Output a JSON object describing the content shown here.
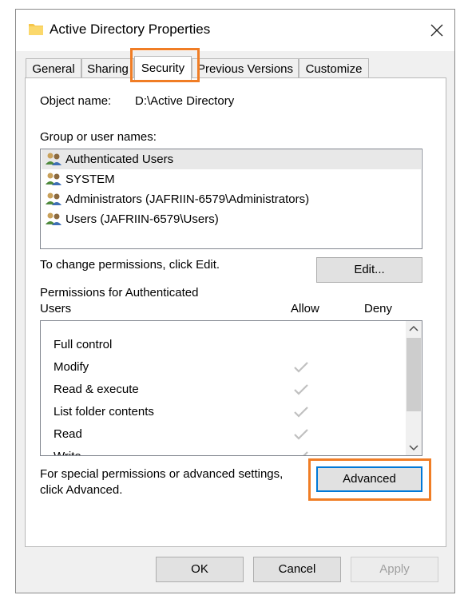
{
  "window": {
    "title": "Active Directory Properties"
  },
  "tabs": [
    {
      "label": "General"
    },
    {
      "label": "Sharing"
    },
    {
      "label": "Security"
    },
    {
      "label": "Previous Versions"
    },
    {
      "label": "Customize"
    }
  ],
  "object": {
    "label": "Object name:",
    "value": "D:\\Active Directory"
  },
  "groups": {
    "label": "Group or user names:",
    "items": [
      {
        "name": "Authenticated Users"
      },
      {
        "name": "SYSTEM"
      },
      {
        "name": "Administrators (JAFRIIN-6579\\Administrators)"
      },
      {
        "name": "Users (JAFRIIN-6579\\Users)"
      }
    ]
  },
  "edit": {
    "hint": "To change permissions, click Edit.",
    "button": "Edit..."
  },
  "permissions": {
    "title_line1": "Permissions for Authenticated",
    "title_line2": "Users",
    "allow_header": "Allow",
    "deny_header": "Deny",
    "items": [
      {
        "name": "Full control",
        "allow": false
      },
      {
        "name": "Modify",
        "allow": true
      },
      {
        "name": "Read & execute",
        "allow": true
      },
      {
        "name": "List folder contents",
        "allow": true
      },
      {
        "name": "Read",
        "allow": true
      },
      {
        "name": "Write",
        "allow": true
      }
    ]
  },
  "advanced": {
    "hint_line1": "For special permissions or advanced settings,",
    "hint_line2": "click Advanced.",
    "button": "Advanced"
  },
  "footer": {
    "ok": "OK",
    "cancel": "Cancel",
    "apply": "Apply"
  },
  "colors": {
    "highlight": "#f07d25",
    "checkmark": "#c0c0c0",
    "dialog_bg": "#f0f0f0"
  }
}
